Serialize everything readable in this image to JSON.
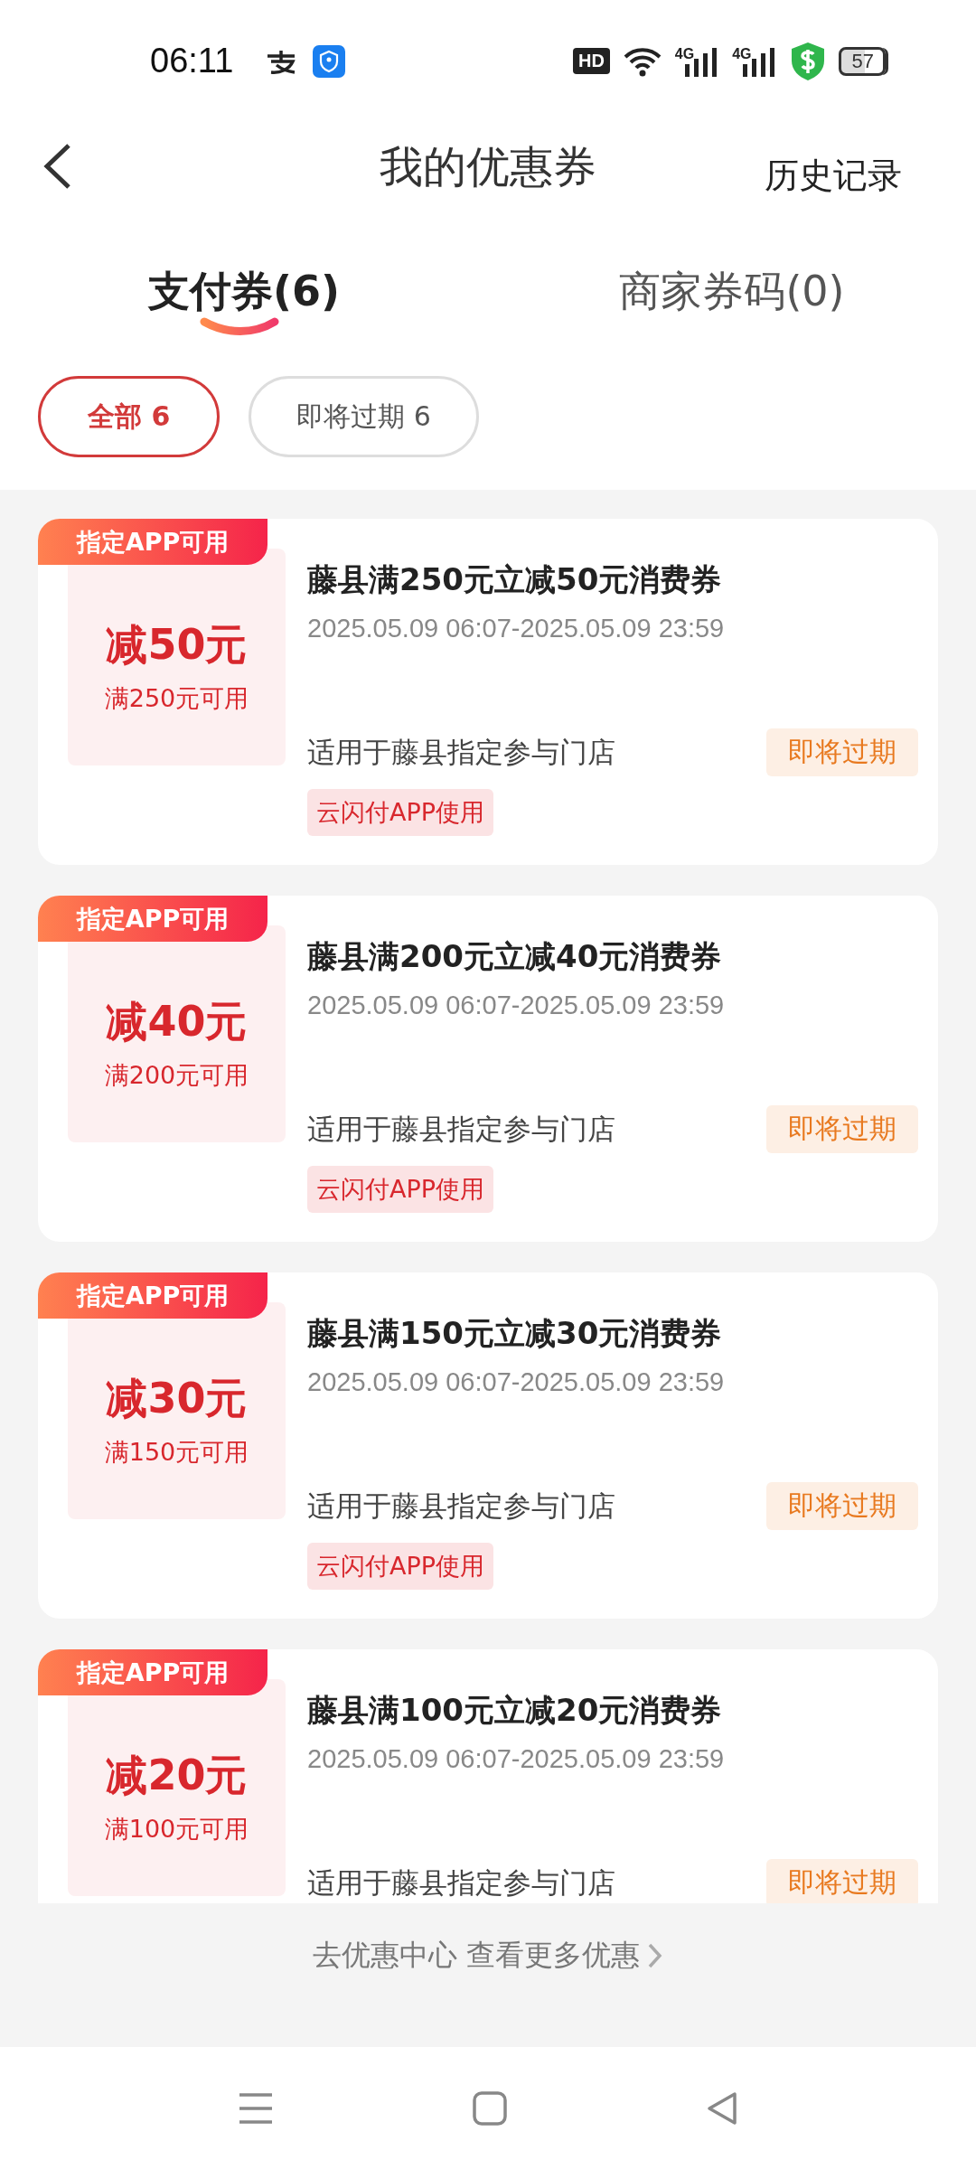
{
  "status_bar": {
    "time": "06:11",
    "hd_badge": "HD",
    "network_1": "4G",
    "network_2": "4G",
    "battery": "57"
  },
  "header": {
    "title": "我的优惠券",
    "history": "历史记录"
  },
  "tabs": [
    {
      "label": "支付券(6)",
      "selected": true
    },
    {
      "label": "商家券码(0)",
      "selected": false
    }
  ],
  "filters": [
    {
      "label": "全部 6",
      "selected": true
    },
    {
      "label": "即将过期 6",
      "selected": false
    }
  ],
  "coupons": [
    {
      "ribbon": "指定APP可用",
      "amount": "减50元",
      "threshold": "满250元可用",
      "title": "藤县满250元立减50元消费券",
      "period": "2025.05.09 06:07-2025.05.09 23:59",
      "scope": "适用于藤县指定参与门店",
      "status": "即将过期",
      "app_tag": "云闪付APP使用"
    },
    {
      "ribbon": "指定APP可用",
      "amount": "减40元",
      "threshold": "满200元可用",
      "title": "藤县满200元立减40元消费券",
      "period": "2025.05.09 06:07-2025.05.09 23:59",
      "scope": "适用于藤县指定参与门店",
      "status": "即将过期",
      "app_tag": "云闪付APP使用"
    },
    {
      "ribbon": "指定APP可用",
      "amount": "减30元",
      "threshold": "满150元可用",
      "title": "藤县满150元立减30元消费券",
      "period": "2025.05.09 06:07-2025.05.09 23:59",
      "scope": "适用于藤县指定参与门店",
      "status": "即将过期",
      "app_tag": "云闪付APP使用"
    },
    {
      "ribbon": "指定APP可用",
      "amount": "减20元",
      "threshold": "满100元可用",
      "title": "藤县满100元立减20元消费券",
      "period": "2025.05.09 06:07-2025.05.09 23:59",
      "scope": "适用于藤县指定参与门店",
      "status": "即将过期"
    }
  ],
  "footer_link": "去优惠中心 查看更多优惠"
}
